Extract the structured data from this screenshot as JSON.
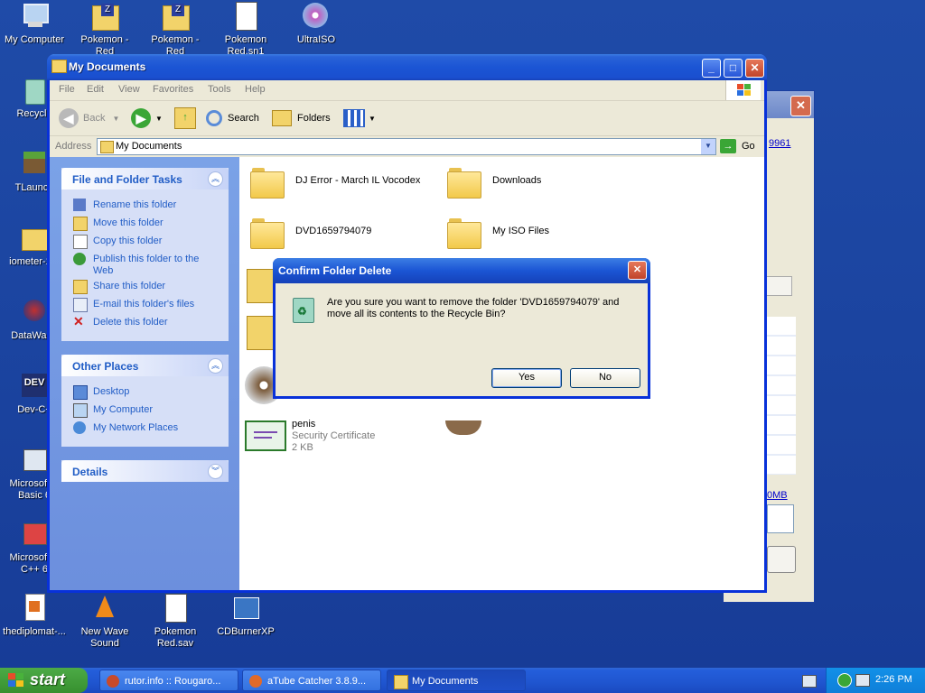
{
  "desktop_icons": [
    {
      "label": "My Computer"
    },
    {
      "label": "Pokemon - Red\nVersion (UE)[!]..."
    },
    {
      "label": "Pokemon - Red\nVersion (UE)..."
    },
    {
      "label": "Pokemon\nRed.sn1"
    },
    {
      "label": "UltraISO"
    },
    {
      "label": "Recycle"
    },
    {
      "label": "TLaunch"
    },
    {
      "label": "iometer-1..."
    },
    {
      "label": "DataWago"
    },
    {
      "label": "Dev-C+"
    },
    {
      "label": "Microsoft V\nBasic 6"
    },
    {
      "label": "Microsoft V\nC++ 6"
    },
    {
      "label": "thediplomat-..."
    },
    {
      "label": "New Wave\nSound"
    },
    {
      "label": "Pokemon\nRed.sav"
    },
    {
      "label": "CDBurnerXP"
    }
  ],
  "back_window": {
    "link": "9961",
    "link2": "0MB"
  },
  "window": {
    "title": "My Documents",
    "menu": [
      "File",
      "Edit",
      "View",
      "Favorites",
      "Tools",
      "Help"
    ],
    "toolbar": {
      "back": "Back",
      "search": "Search",
      "folders": "Folders"
    },
    "address": {
      "label": "Address",
      "value": "My Documents",
      "go": "Go"
    }
  },
  "tasks_panel": {
    "title": "File and Folder Tasks",
    "items": [
      "Rename this folder",
      "Move this folder",
      "Copy this folder",
      "Publish this folder to the Web",
      "Share this folder",
      "E-mail this folder's files",
      "Delete this folder"
    ]
  },
  "places_panel": {
    "title": "Other Places",
    "items": [
      "Desktop",
      "My Computer",
      "My Network Places"
    ]
  },
  "details_panel": {
    "title": "Details"
  },
  "files": [
    {
      "name": "DJ Error - March IL Vocodex"
    },
    {
      "name": "Downloads"
    },
    {
      "name": "DVD1659794079"
    },
    {
      "name": "My ISO Files"
    }
  ],
  "certificate": {
    "name": "penis",
    "type": "Security Certificate",
    "size": "2 KB"
  },
  "dialog": {
    "title": "Confirm Folder Delete",
    "message": "Are you sure you want to remove the folder 'DVD1659794079' and move all its contents to the Recycle Bin?",
    "yes": "Yes",
    "no": "No"
  },
  "taskbar": {
    "start": "start",
    "tasks": [
      "rutor.info :: Rougaro...",
      "aTube Catcher 3.8.9...",
      "My Documents"
    ],
    "clock": "2:26 PM"
  }
}
